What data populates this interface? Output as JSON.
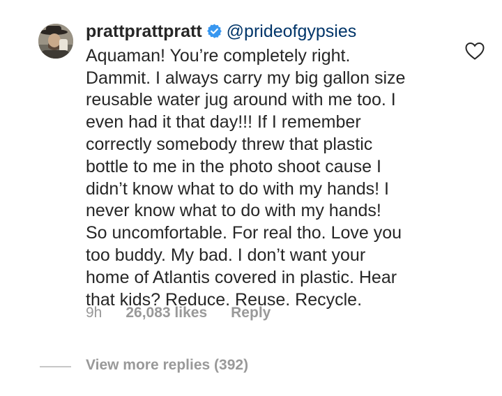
{
  "comment": {
    "username": "prattprattpratt",
    "verified_icon": "verified-badge-icon",
    "mention": "@prideofgypsies",
    "text": "Aquaman! You’re completely right.\nDammit. I always carry my big gallon size\nreusable water jug around with me too. I\neven had it that day!!! If I remember\ncorrectly somebody threw that plastic\nbottle to me in the photo shoot cause I\ndidn’t know what to do with my hands! I\nnever know what to do with my hands!\nSo uncomfortable. For real tho. Love you\ntoo buddy. My bad. I don’t want your\nhome of Atlantis covered in plastic. Hear\nthat kids? Reduce. Reuse. Recycle.",
    "time": "9h",
    "likes": "26,083 likes",
    "reply_label": "Reply",
    "like_icon": "heart-outline-icon"
  },
  "replies": {
    "view_more_label": "View more replies (392)"
  },
  "colors": {
    "text": "#262626",
    "mention": "#003569",
    "muted": "#999999",
    "verified": "#3897f0"
  }
}
